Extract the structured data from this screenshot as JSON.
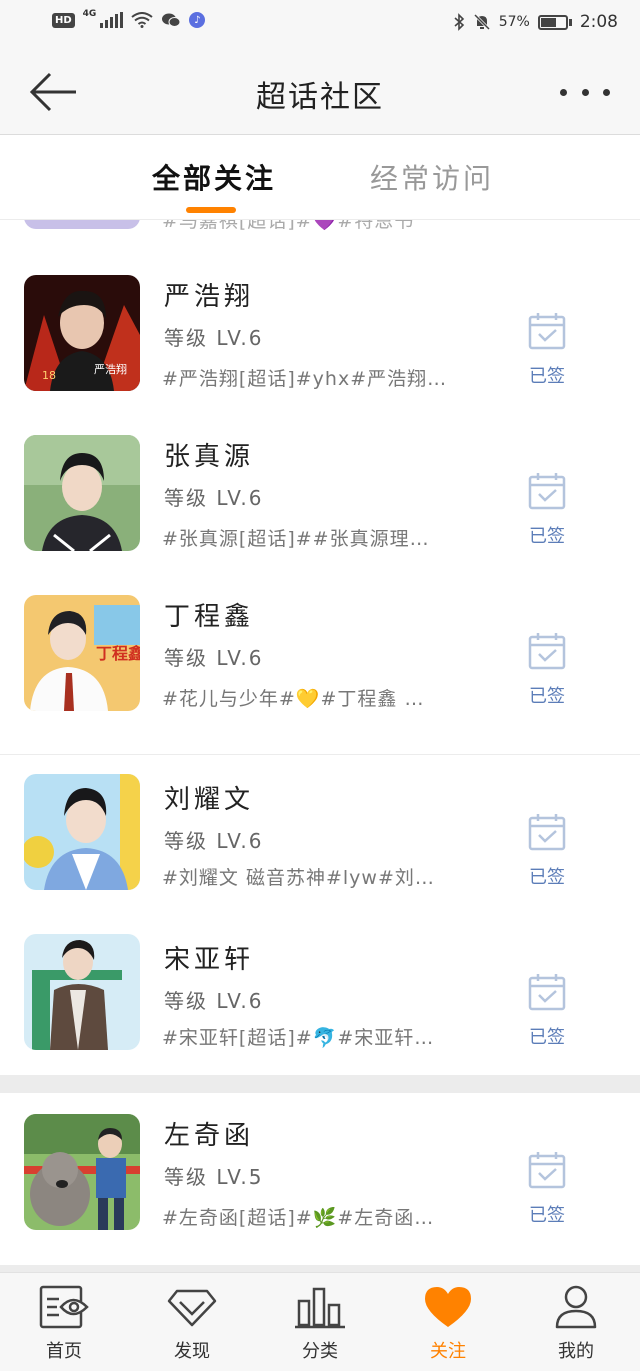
{
  "status_bar": {
    "hd": "HD",
    "network": "4G",
    "battery": "57%",
    "time": "2:08"
  },
  "header": {
    "title": "超话社区",
    "back_icon": "arrow-left-icon",
    "more_icon": "more-dots-icon"
  },
  "tabs": [
    {
      "label": "全部关注",
      "active": true
    },
    {
      "label": "经常访问",
      "active": false
    }
  ],
  "partial_row": {
    "tags": "#马嘉祺[超话]#💜#特恩书"
  },
  "communities": [
    {
      "name": "严浩翔",
      "level": "等级 LV.6",
      "tags": "#严浩翔[超话]#yhx#严浩翔…",
      "sign_label": "已签",
      "avatar_colors": [
        "#3a1210",
        "#c0301c"
      ]
    },
    {
      "name": "张真源",
      "level": "等级 LV.6",
      "tags": "#张真源[超话]##张真源理…",
      "sign_label": "已签",
      "avatar_colors": [
        "#7aa070",
        "#2a2a2e"
      ]
    },
    {
      "name": "丁程鑫",
      "level": "等级 LV.6",
      "tags": "#花儿与少年#💛#丁程鑫 …",
      "sign_label": "已签",
      "avatar_colors": [
        "#f4c870",
        "#f7f2ea"
      ]
    },
    {
      "name": "刘耀文",
      "level": "等级 LV.6",
      "tags": "#刘耀文 磁音苏神#lyw#刘…",
      "sign_label": "已签",
      "avatar_colors": [
        "#9ed0f0",
        "#f5d24a"
      ]
    },
    {
      "name": "宋亚轩",
      "level": "等级 LV.6",
      "tags": "#宋亚轩[超话]#🐬#宋亚轩…",
      "sign_label": "已签",
      "avatar_colors": [
        "#cfe8f4",
        "#5b4a40"
      ]
    },
    {
      "name": "左奇函",
      "level": "等级 LV.5",
      "tags": "#左奇函[超话]#🌿#左奇函…",
      "sign_label": "已签",
      "avatar_colors": [
        "#9bc070",
        "#8a8078"
      ]
    }
  ],
  "bottom_nav": [
    {
      "label": "首页",
      "icon": "home-eye-icon",
      "active": false
    },
    {
      "label": "发现",
      "icon": "diamond-icon",
      "active": false
    },
    {
      "label": "分类",
      "icon": "bar-chart-icon",
      "active": false
    },
    {
      "label": "关注",
      "icon": "heart-icon",
      "active": true
    },
    {
      "label": "我的",
      "icon": "person-icon",
      "active": false
    }
  ],
  "colors": {
    "accent": "#ff8200",
    "sign_blue": "#5c7db8",
    "background": "#ffffff",
    "bar_background": "#f7f7f7"
  }
}
